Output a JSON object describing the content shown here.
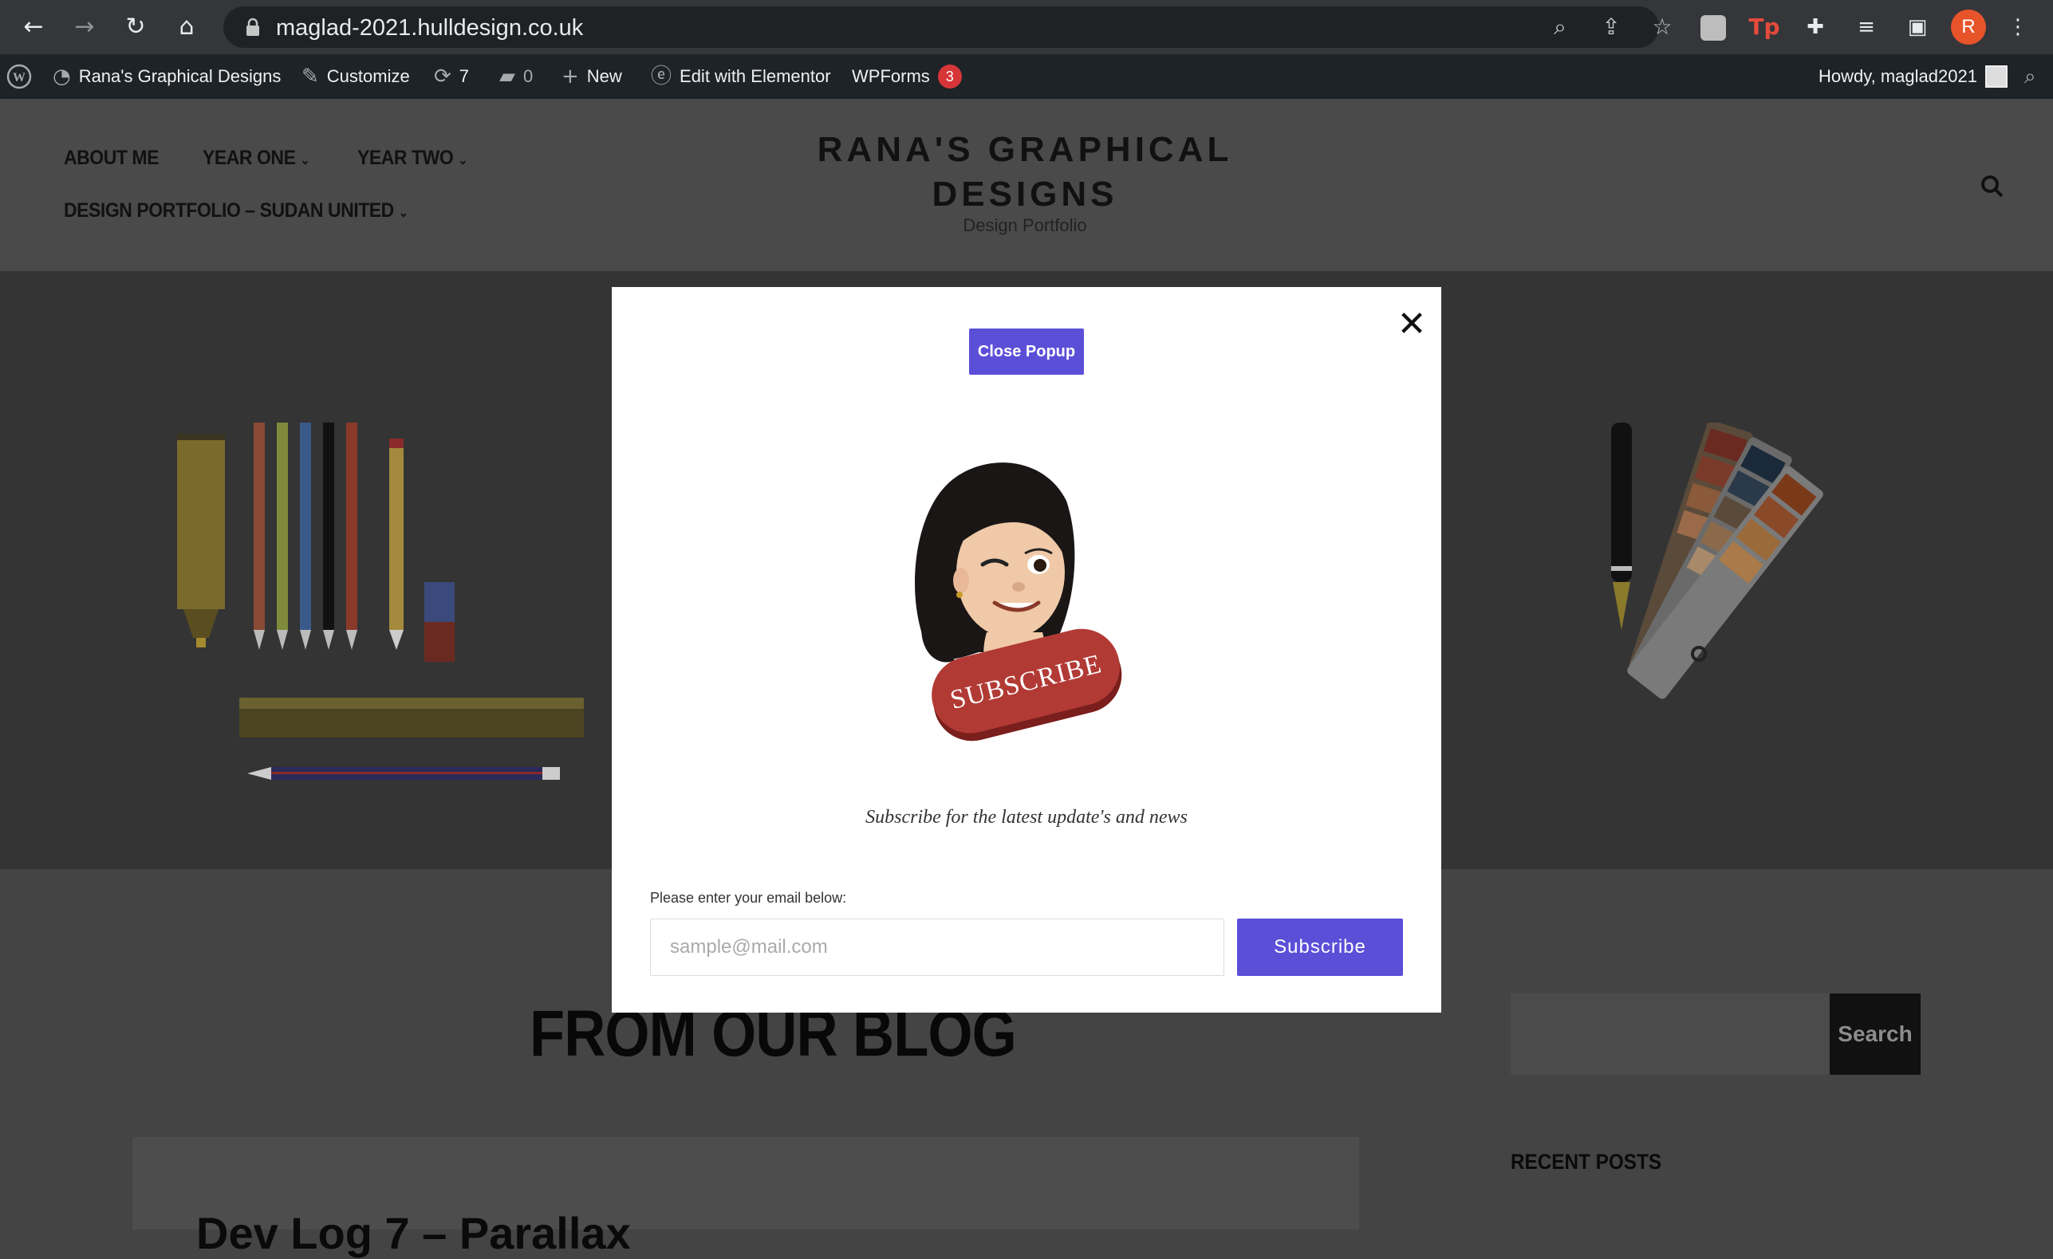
{
  "browser": {
    "url": "maglad-2021.hulldesign.co.uk",
    "profile_initial": "R"
  },
  "admin_bar": {
    "site_name": "Rana's Graphical Designs",
    "customize": "Customize",
    "updates_count": "7",
    "comments_count": "0",
    "new": "New",
    "elementor": "Edit with Elementor",
    "wpforms": "WPForms",
    "wpforms_badge": "3",
    "howdy": "Howdy, maglad2021"
  },
  "header": {
    "menu": [
      {
        "label": "ABOUT ME",
        "has_dropdown": false
      },
      {
        "label": "YEAR ONE",
        "has_dropdown": true
      },
      {
        "label": "YEAR TWO",
        "has_dropdown": true
      },
      {
        "label": "DESIGN PORTFOLIO – SUDAN UNITED",
        "has_dropdown": true
      }
    ],
    "site_title_line1": "RANA'S GRAPHICAL",
    "site_title_line2": "DESIGNS",
    "tagline": "Design Portfolio"
  },
  "content": {
    "blog_heading": "FROM OUR BLOG",
    "post_title": "Dev Log 7 – Parallax",
    "sidebar_search_button": "Search",
    "recent_posts": "RECENT POSTS"
  },
  "popup": {
    "close_button": "Close Popup",
    "sticker_text": "SUBSCRIBE",
    "subscribe_text": "Subscribe for the latest update's and news",
    "email_label": "Please enter your email below:",
    "email_placeholder": "sample@mail.com",
    "subscribe_button": "Subscribe"
  },
  "colors": {
    "accent": "#5b4fd8",
    "sticker_red": "#b23a35",
    "hero_bg": "#343434",
    "header_bg": "#4a4a4a"
  }
}
